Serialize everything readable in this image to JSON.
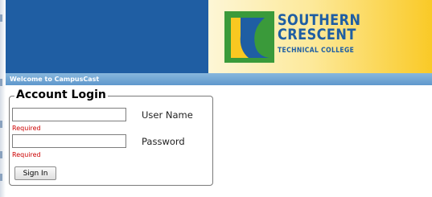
{
  "header": {
    "logo_line1": "SOUTHERN",
    "logo_line2": "CRESCENT",
    "logo_line3": "TECHNICAL COLLEGE",
    "brand_blue": "#1f5ea3",
    "brand_yellow": "#f9c821",
    "brand_green": "#3a9a3a"
  },
  "welcome": {
    "text": "Welcome to CampusCast"
  },
  "login": {
    "legend": "Account Login",
    "username_label": "User Name",
    "username_value": "",
    "username_required": "Required",
    "password_label": "Password",
    "password_value": "",
    "password_required": "Required",
    "sign_in_label": "Sign In"
  }
}
